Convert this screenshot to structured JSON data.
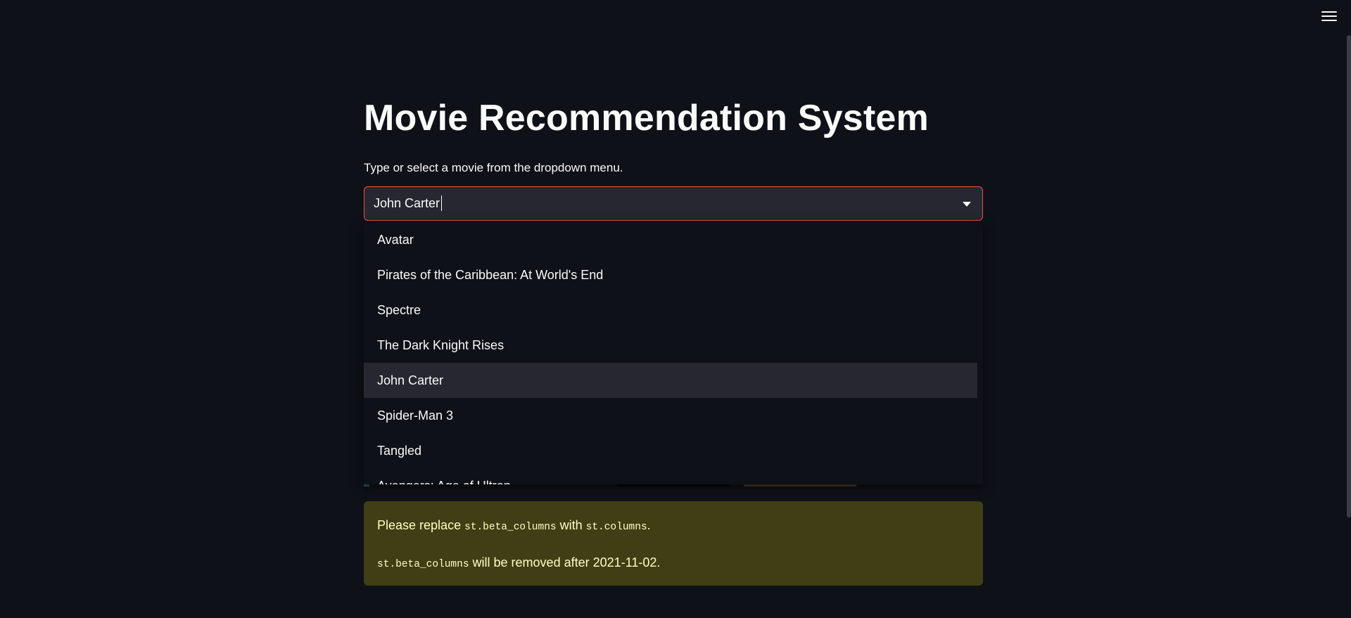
{
  "header": {
    "menu_icon": "hamburger-menu-icon"
  },
  "main": {
    "title": "Movie Recommendation System",
    "select_label": "Type or select a movie from the dropdown menu.",
    "select_value": "John Carter",
    "dropdown_options": [
      "Avatar",
      "Pirates of the Caribbean: At World's End",
      "Spectre",
      "The Dark Knight Rises",
      "John Carter",
      "Spider-Man 3",
      "Tangled",
      "Avengers: Age of Ultron"
    ],
    "active_option_index": 4
  },
  "warning": {
    "line1_prefix": "Please replace ",
    "line1_code1": "st.beta_columns",
    "line1_mid": " with ",
    "line1_code2": "st.columns",
    "line1_suffix": ".",
    "line2_code": "st.beta_columns",
    "line2_suffix": " will be removed after 2021-11-02."
  },
  "colors": {
    "background": "#0e1117",
    "input_bg": "#262730",
    "accent": "#ff4b4b",
    "warning_bg": "#413e16",
    "warning_text": "#ffffc2"
  }
}
